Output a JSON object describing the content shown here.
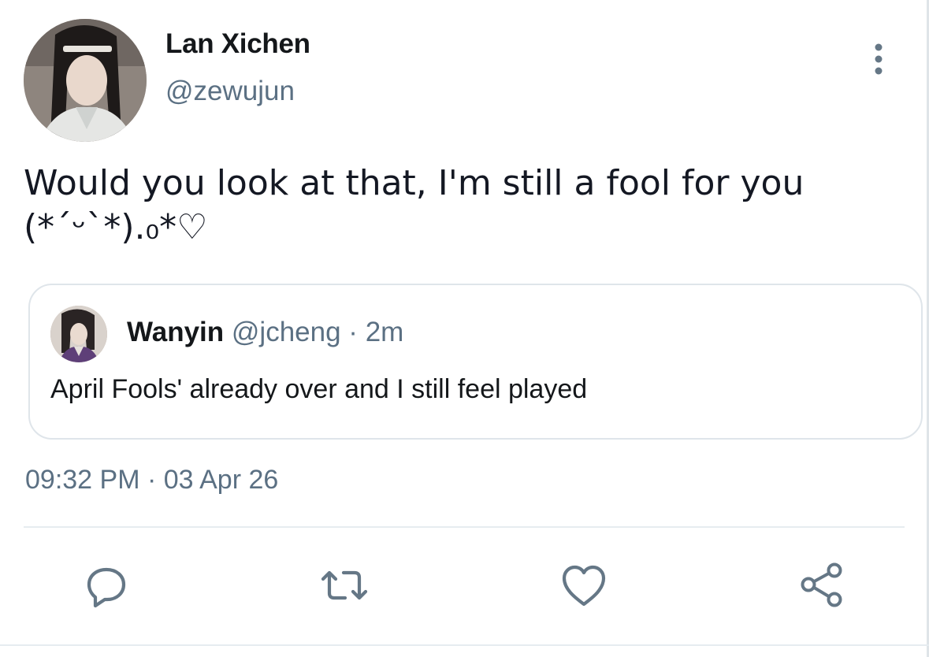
{
  "tweet": {
    "author": {
      "display_name": "Lan Xichen",
      "handle": "@zewujun"
    },
    "text_lines": [
      "Would you look at that, I'm still a fool for you",
      "(*ˊᵕˋ*).₀*♡"
    ],
    "timestamp": "09:32 PM · 03 Apr 26"
  },
  "quoted_tweet": {
    "author": {
      "display_name": "Wanyin",
      "handle": "@jcheng"
    },
    "separator": "·",
    "age": "2m",
    "text": "April Fools' already over and I still feel played"
  },
  "actions": [
    {
      "icon": "reply-icon"
    },
    {
      "icon": "retweet-icon"
    },
    {
      "icon": "like-icon"
    },
    {
      "icon": "share-icon"
    }
  ],
  "colors": {
    "text_primary": "#14171a",
    "text_secondary": "#5b7083",
    "icon": "#657786",
    "border": "#dfe5ea"
  }
}
